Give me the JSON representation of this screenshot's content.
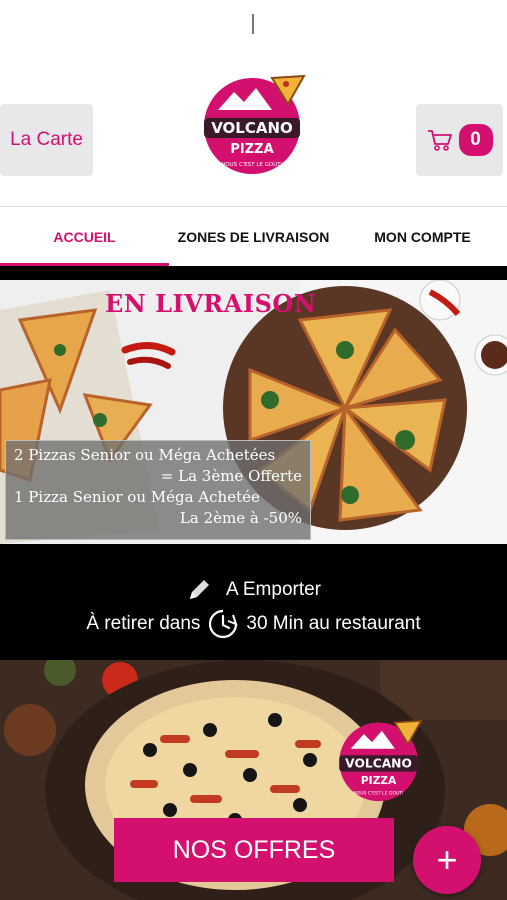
{
  "header": {
    "carte_label": "La Carte",
    "cart_count": "0",
    "logo_text": "VOLCANO",
    "logo_sub": "PIZZA",
    "logo_slogan": "NOUS C'EST LE GOUT!"
  },
  "tabs": [
    {
      "label": "ACCUEIL"
    },
    {
      "label": "ZONES DE LIVRAISON"
    },
    {
      "label": "MON COMPTE"
    }
  ],
  "promo": {
    "title": "EN LIVRAISON",
    "line1": "2 Pizzas Senior ou Méga Achetées",
    "line2": "= La 3ème Offerte",
    "line3": "1 Pizza Senior ou Méga Achetée",
    "line4": "La 2ème à -50%"
  },
  "emporter": {
    "title": "A Emporter",
    "pre": "À retirer dans",
    "post": "30 Min au restaurant"
  },
  "hero": {
    "cta_label": "NOS OFFRES",
    "fab_symbol": "+"
  },
  "colors": {
    "brand": "#d4106f"
  }
}
